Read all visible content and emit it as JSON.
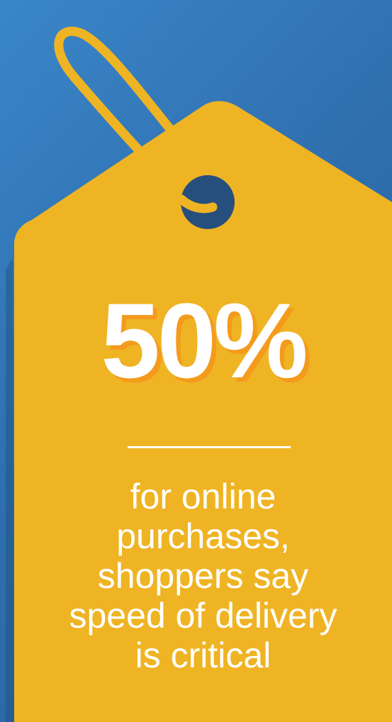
{
  "tag": {
    "stat": "50%",
    "caption_lines": [
      "for online",
      "purchases,",
      "shoppers say",
      "speed of delivery",
      "is critical"
    ]
  },
  "colors": {
    "background": "#2f6fae",
    "tag": "#efb424",
    "stat_shadow": "#f49a1c",
    "hole": "#274f7e",
    "text": "#ffffff"
  }
}
